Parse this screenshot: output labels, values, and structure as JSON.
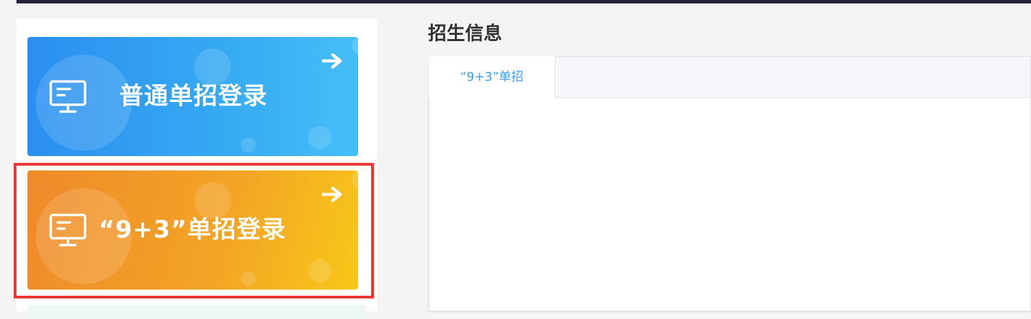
{
  "login_cards": [
    {
      "label": "普通单招登录",
      "icon": "monitor-icon",
      "arrow_icon": "arrow-right-icon"
    },
    {
      "label": "“9+3”单招登录",
      "icon": "monitor-icon",
      "arrow_icon": "arrow-right-icon"
    }
  ],
  "content": {
    "section_title": "招生信息",
    "tabs": [
      {
        "label": "“9+3”单招",
        "active": true
      }
    ]
  },
  "colors": {
    "top_bar": "#25233a",
    "card_blue_start": "#2b8ff0",
    "card_blue_end": "#45bff7",
    "card_orange_start": "#ee8a2a",
    "card_orange_end": "#f7c818",
    "highlight": "#ee3333",
    "tab_active_text": "#409eff"
  }
}
